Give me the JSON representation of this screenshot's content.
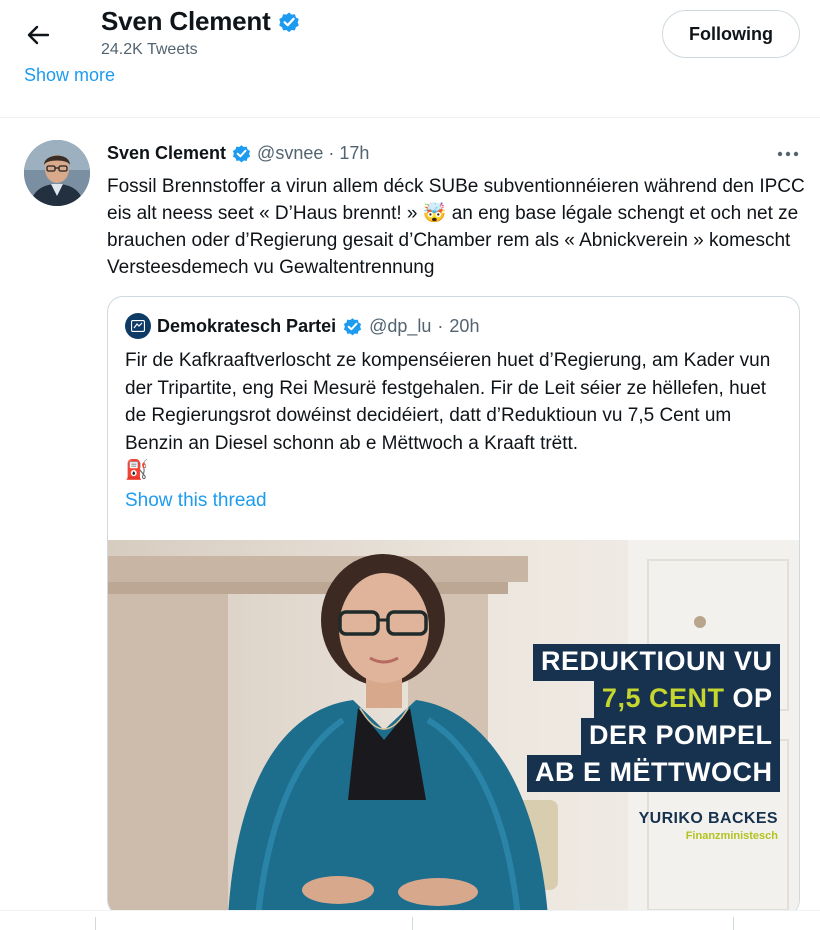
{
  "header": {
    "name": "Sven Clement",
    "tweet_count": "24.2K Tweets",
    "follow_label": "Following",
    "show_more_label": "Show more"
  },
  "tweet": {
    "author_name": "Sven Clement",
    "handle": "@svnee",
    "separator": "·",
    "time": "17h",
    "text": "Fossil Brennstoffer a virun allem déck SUBe subventionnéieren während den IPCC eis alt neess seet « D’Haus brennt! » 🤯 an eng base légale schengt et och net ze brauchen oder d’Regierung gesait d’Chamber rem als « Abnickverein » komescht Versteesdemech vu Gewaltentrennung"
  },
  "quote": {
    "author_name": "Demokratesch Partei",
    "handle": "@dp_lu",
    "separator": "·",
    "time": "20h",
    "text": "Fir de Kafkraaftverloscht ze kompenséieren huet d’Regierung, am Kader vun der Tripartite, eng Rei Mesurë festgehalen. Fir de Leit séier ze hëllefen, huet de Regierungsrot dowéinst decidéiert, datt d’Reduktioun vu 7,5 Cent um Benzin an Diesel schonn ab e Mëttwoch a Kraaft trëtt.",
    "emoji": "⛽",
    "show_thread_label": "Show this thread",
    "image": {
      "line1": "REDUKTIOUN VU",
      "line2_accent": "7,5 CENT",
      "line2_rest": " OP",
      "line3": "DER POMPEL",
      "line4": "AB E MËTTWOCH",
      "person_name": "YURIKO BACKES",
      "person_role": "Finanzministesch"
    }
  },
  "colors": {
    "link_blue": "#1d9bf0",
    "verified_blue": "#1d9bf0",
    "overlay_navy": "#16324f",
    "overlay_accent": "#c5d62e"
  },
  "icons": [
    "back-arrow-icon",
    "verified-badge-icon",
    "more-icon",
    "fuel-pump-icon"
  ]
}
